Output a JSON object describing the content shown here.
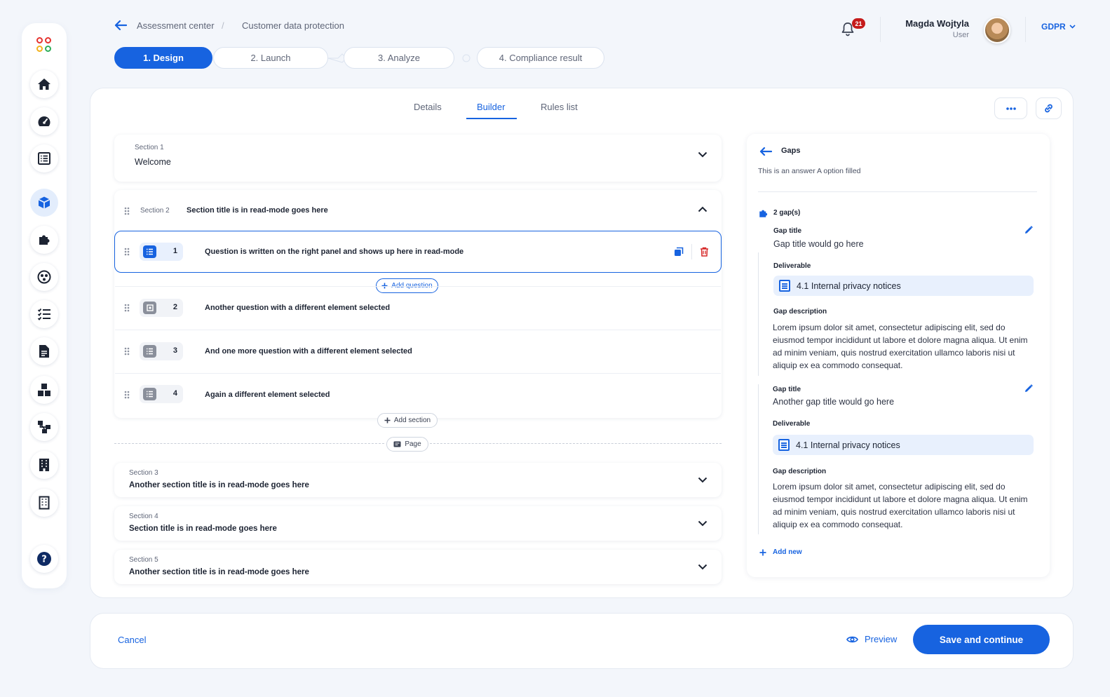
{
  "breadcrumb": [
    "Assessment center",
    "Customer data protection"
  ],
  "header": {
    "notification_count": "21",
    "user_name": "Magda Wojtyla",
    "user_role": "User",
    "language": "GDPR"
  },
  "steps": [
    "1. Design",
    "2. Launch",
    "3. Analyze",
    "4. Compliance result"
  ],
  "tabs": [
    "Details",
    "Builder",
    "Rules list"
  ],
  "sections": {
    "s1": {
      "label": "Section 1",
      "title": "Welcome"
    },
    "s2": {
      "label": "Section 2",
      "title": "Section title is in read-mode goes here"
    },
    "s3": {
      "label": "Section 3",
      "title": "Another section title is in read-mode goes here"
    },
    "s4": {
      "label": "Section 4",
      "title": "Section title is in read-mode goes here"
    },
    "s5": {
      "label": "Section 5",
      "title": "Another section title is in read-mode goes here"
    }
  },
  "questions": [
    {
      "num": "1",
      "text": "Question is written on the right panel and shows up here in read-mode"
    },
    {
      "num": "2",
      "text": "Another question with a different element selected"
    },
    {
      "num": "3",
      "text": "And one more question with a different element selected"
    },
    {
      "num": "4",
      "text": "Again a different element selected"
    }
  ],
  "actions": {
    "add_question": "Add question",
    "add_section": "Add section",
    "page": "Page"
  },
  "gaps": {
    "title": "Gaps",
    "subtitle": "This is an answer A option filled",
    "count": "2 gap(s)",
    "gap_title_label": "Gap title",
    "deliverable_label": "Deliverable",
    "description_label": "Gap description",
    "items": [
      {
        "title": "Gap title would go here",
        "deliverable": "4.1 Internal privacy notices",
        "description": "Lorem ipsum dolor sit amet, consectetur adipiscing elit, sed do eiusmod tempor incididunt ut labore et dolore magna aliqua. Ut enim ad minim veniam, quis nostrud exercitation ullamco laboris nisi ut aliquip ex ea commodo consequat."
      },
      {
        "title": "Another gap title would go here",
        "deliverable": "4.1 Internal privacy notices",
        "description": "Lorem ipsum dolor sit amet, consectetur adipiscing elit, sed do eiusmod tempor incididunt ut labore et dolore magna aliqua. Ut enim ad minim veniam, quis nostrud exercitation ullamco laboris nisi ut aliquip ex ea commodo consequat."
      }
    ],
    "add_new": "Add new"
  },
  "footer": {
    "cancel": "Cancel",
    "preview": "Preview",
    "save": "Save and continue"
  },
  "colors": {
    "primary": "#1763e0",
    "danger": "#c51b1b",
    "background": "#f3f6fb"
  }
}
